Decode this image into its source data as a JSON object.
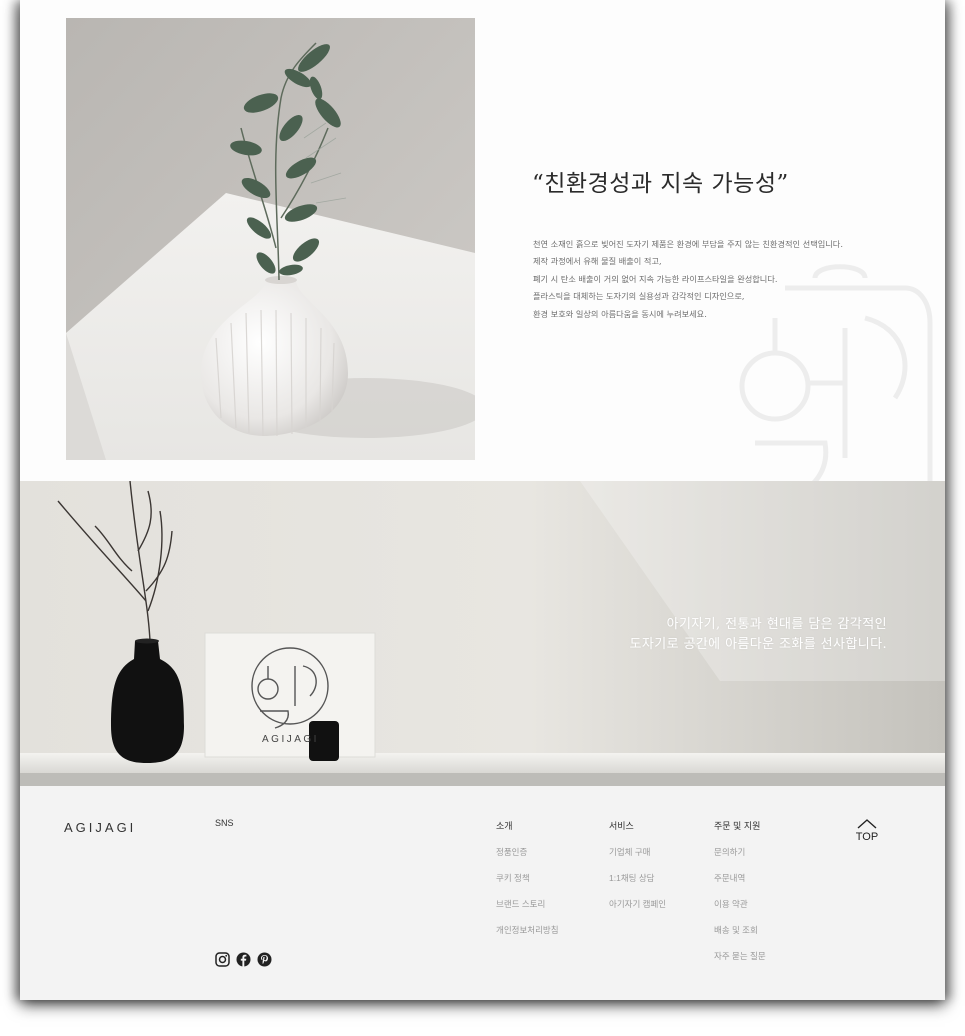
{
  "section1": {
    "quote": "“친환경성과 지속 가능성”",
    "body_lines": [
      "천연 소재인 흙으로 빚어진 도자기 제품은 환경에 부담을 주지 않는 친환경적인 선택입니다.",
      "제작 과정에서 유해 물질 배출이 적고,",
      "폐기 시 탄소 배출이 거의 없어 지속 가능한 라이프스타일을 완성합니다.",
      "플라스틱을 대체하는 도자기의 실용성과 감각적인 디자인으로,",
      "환경 보호와 일상의 아름다움을 동시에 누려보세요."
    ]
  },
  "section2": {
    "hero_line1": "아기자기, 전통과 현대를 담은 감각적인",
    "hero_line2": "도자기로 공간에 아름다운 조화를 선사합니다.",
    "box_brand": "AGIJAGI",
    "box_logo_text": "아기"
  },
  "footer": {
    "logo": "AGIJAGI",
    "sns_label": "SNS",
    "columns": [
      {
        "title": "소개",
        "items": [
          "정품인증",
          "쿠키 정책",
          "브랜드 스토리",
          "개인정보처리방침"
        ]
      },
      {
        "title": "서비스",
        "items": [
          "기업체 구매",
          "1:1채팅 상담",
          "아기자기 캠페인"
        ]
      },
      {
        "title": "주문 및 지원",
        "items": [
          "문의하기",
          "주문내역",
          "이용 약관",
          "배송 및 조회",
          "자주 묻는 질문"
        ]
      }
    ],
    "top_label": "TOP",
    "sns_icons": [
      "instagram-icon",
      "facebook-icon",
      "pinterest-icon"
    ]
  },
  "colors": {
    "footer_bg": "#f3f3f3",
    "text_dark": "#333333",
    "text_muted": "#9a9a9a",
    "hero_text": "#ffffff"
  }
}
